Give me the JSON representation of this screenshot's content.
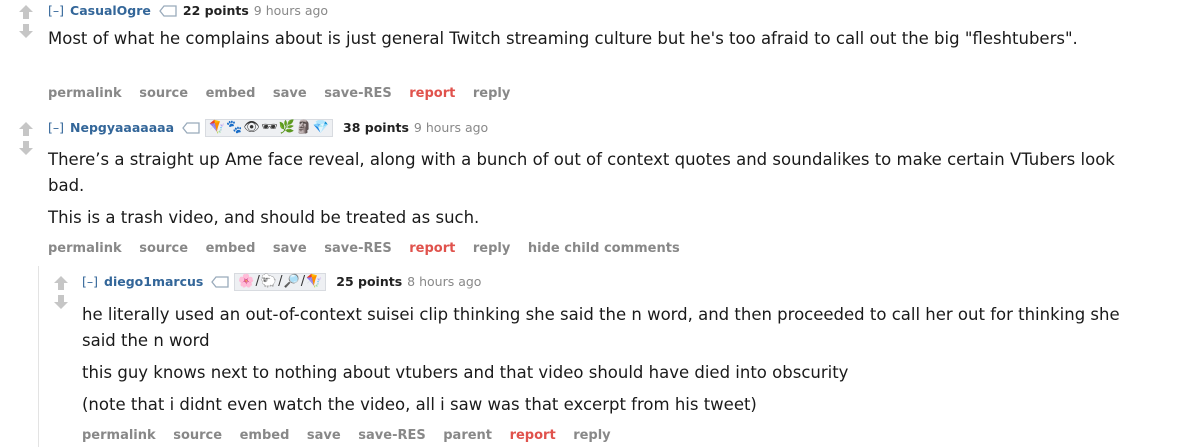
{
  "comments": [
    {
      "expand": "[–]",
      "author": "CasualOgre",
      "score": "22 points",
      "time": "9 hours ago",
      "paragraphs": [
        "Most of what he complains about is just general Twitch streaming culture but he's too afraid to call out the big \"fleshtubers\"."
      ],
      "buttons": [
        "permalink",
        "source",
        "embed",
        "save",
        "save-RES",
        "report",
        "reply"
      ]
    },
    {
      "expand": "[–]",
      "author": "Nepgyaaaaaaa",
      "flair_icons": [
        "🪁",
        "🐾",
        "👁",
        "🕶",
        "🌿",
        "🗿",
        "💎"
      ],
      "score": "38 points",
      "time": "9 hours ago",
      "paragraphs": [
        "There’s a straight up Ame face reveal, along with a bunch of out of context quotes and soundalikes to make certain VTubers look bad.",
        "This is a trash video, and should be treated as such."
      ],
      "buttons": [
        "permalink",
        "source",
        "embed",
        "save",
        "save-RES",
        "report",
        "reply",
        "hide child comments"
      ]
    },
    {
      "expand": "[–]",
      "author": "diego1marcus",
      "flair_icons": [
        "🌸",
        "/",
        "🐑",
        "/",
        "🔎",
        "/",
        "🪁"
      ],
      "score": "25 points",
      "time": "8 hours ago",
      "paragraphs": [
        "he literally used an out-of-context suisei clip thinking she said the n word, and then proceeded to call her out for thinking she said the n word",
        "this guy knows next to nothing about vtubers and that video should have died into obscurity",
        "(note that i didnt even watch the video, all i saw was that excerpt from his tweet)"
      ],
      "buttons": [
        "permalink",
        "source",
        "embed",
        "save",
        "save-RES",
        "parent",
        "report",
        "reply"
      ]
    }
  ],
  "colors": {
    "link": "#336699",
    "report": "#e0524c",
    "muted": "#888888"
  }
}
